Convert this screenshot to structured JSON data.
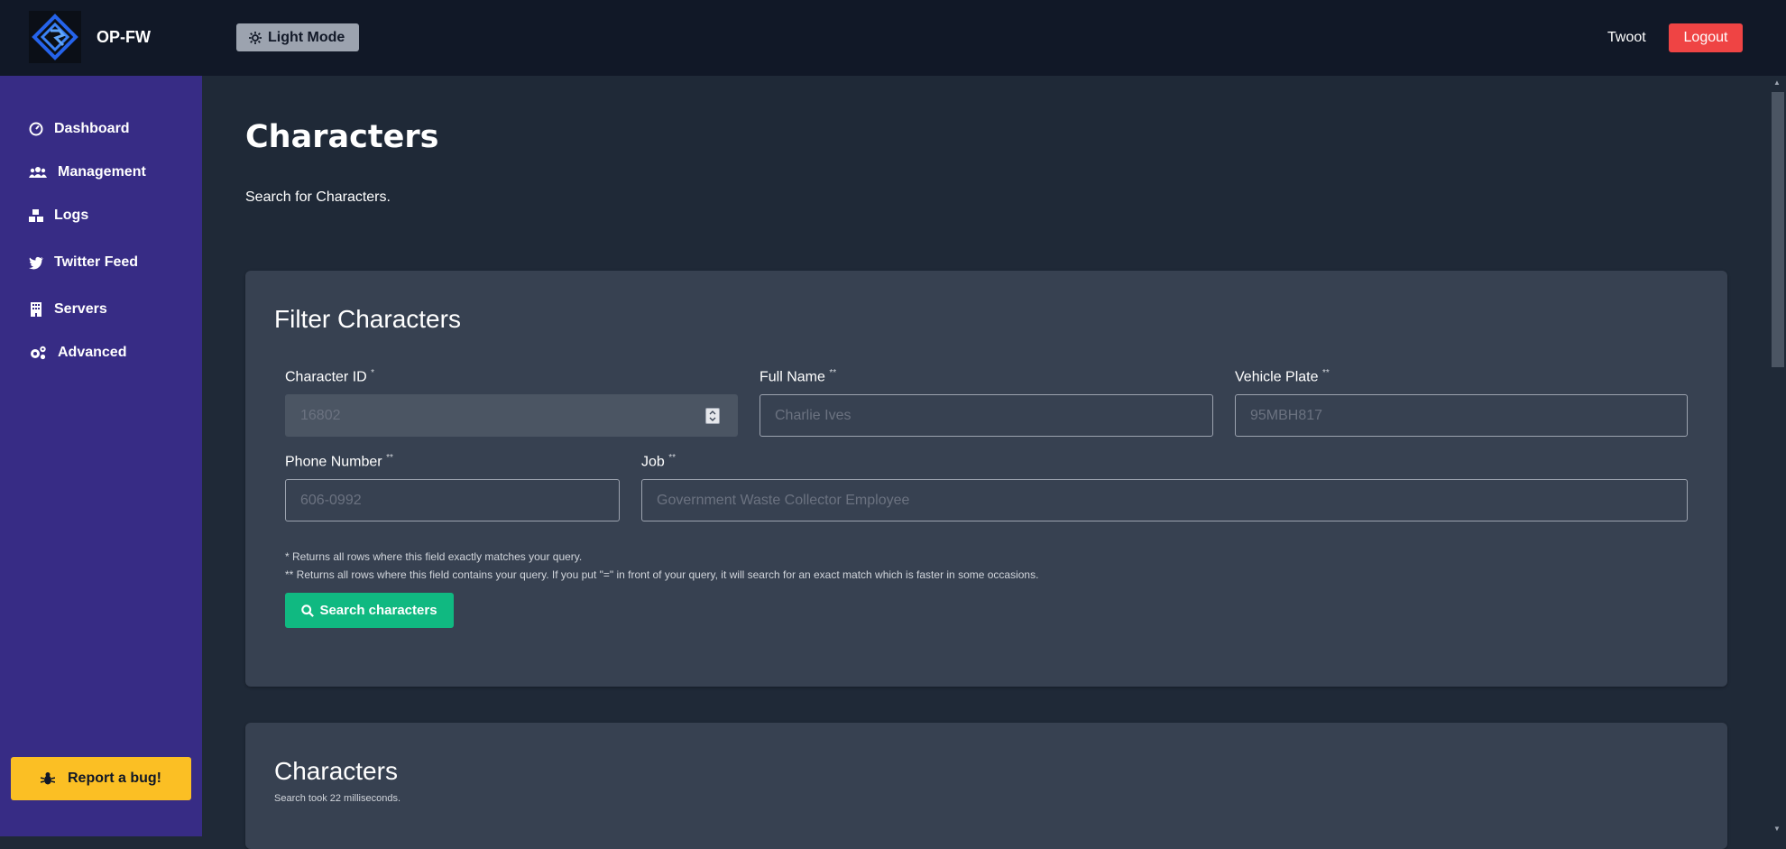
{
  "header": {
    "brand": "OP-FW",
    "mode_button": "Light Mode",
    "user_name": "Twoot",
    "logout": "Logout"
  },
  "sidebar": {
    "items": [
      {
        "label": "Dashboard",
        "icon": "dashboard-icon"
      },
      {
        "label": "Management",
        "icon": "users-icon"
      },
      {
        "label": "Logs",
        "icon": "boxes-icon"
      },
      {
        "label": "Twitter Feed",
        "icon": "twitter-icon"
      },
      {
        "label": "Servers",
        "icon": "building-icon"
      },
      {
        "label": "Advanced",
        "icon": "gears-icon"
      }
    ],
    "bug_button": "Report a bug!"
  },
  "main": {
    "title": "Characters",
    "subtitle": "Search for Characters."
  },
  "filter": {
    "title": "Filter Characters",
    "fields": {
      "character_id": {
        "label": "Character ID",
        "marker": "*",
        "placeholder": "16802"
      },
      "full_name": {
        "label": "Full Name",
        "marker": "**",
        "placeholder": "Charlie Ives"
      },
      "vehicle_plate": {
        "label": "Vehicle Plate",
        "marker": "**",
        "placeholder": "95MBH817"
      },
      "phone_number": {
        "label": "Phone Number",
        "marker": "**",
        "placeholder": "606-0992"
      },
      "job": {
        "label": "Job",
        "marker": "**",
        "placeholder": "Government Waste Collector Employee"
      }
    },
    "note_1": "* Returns all rows where this field exactly matches your query.",
    "note_2": "** Returns all rows where this field contains your query. If you put \"=\" in front of your query, it will search for an exact match which is faster in some occasions.",
    "search_button": "Search characters"
  },
  "results": {
    "title": "Characters",
    "took": "Search took 22 milliseconds."
  },
  "colors": {
    "topbar": "#111827",
    "sidebar": "#372c85",
    "background": "#1f2937",
    "card": "#374151",
    "logout": "#ef4444",
    "search": "#10b981",
    "bug": "#fbbf24"
  }
}
